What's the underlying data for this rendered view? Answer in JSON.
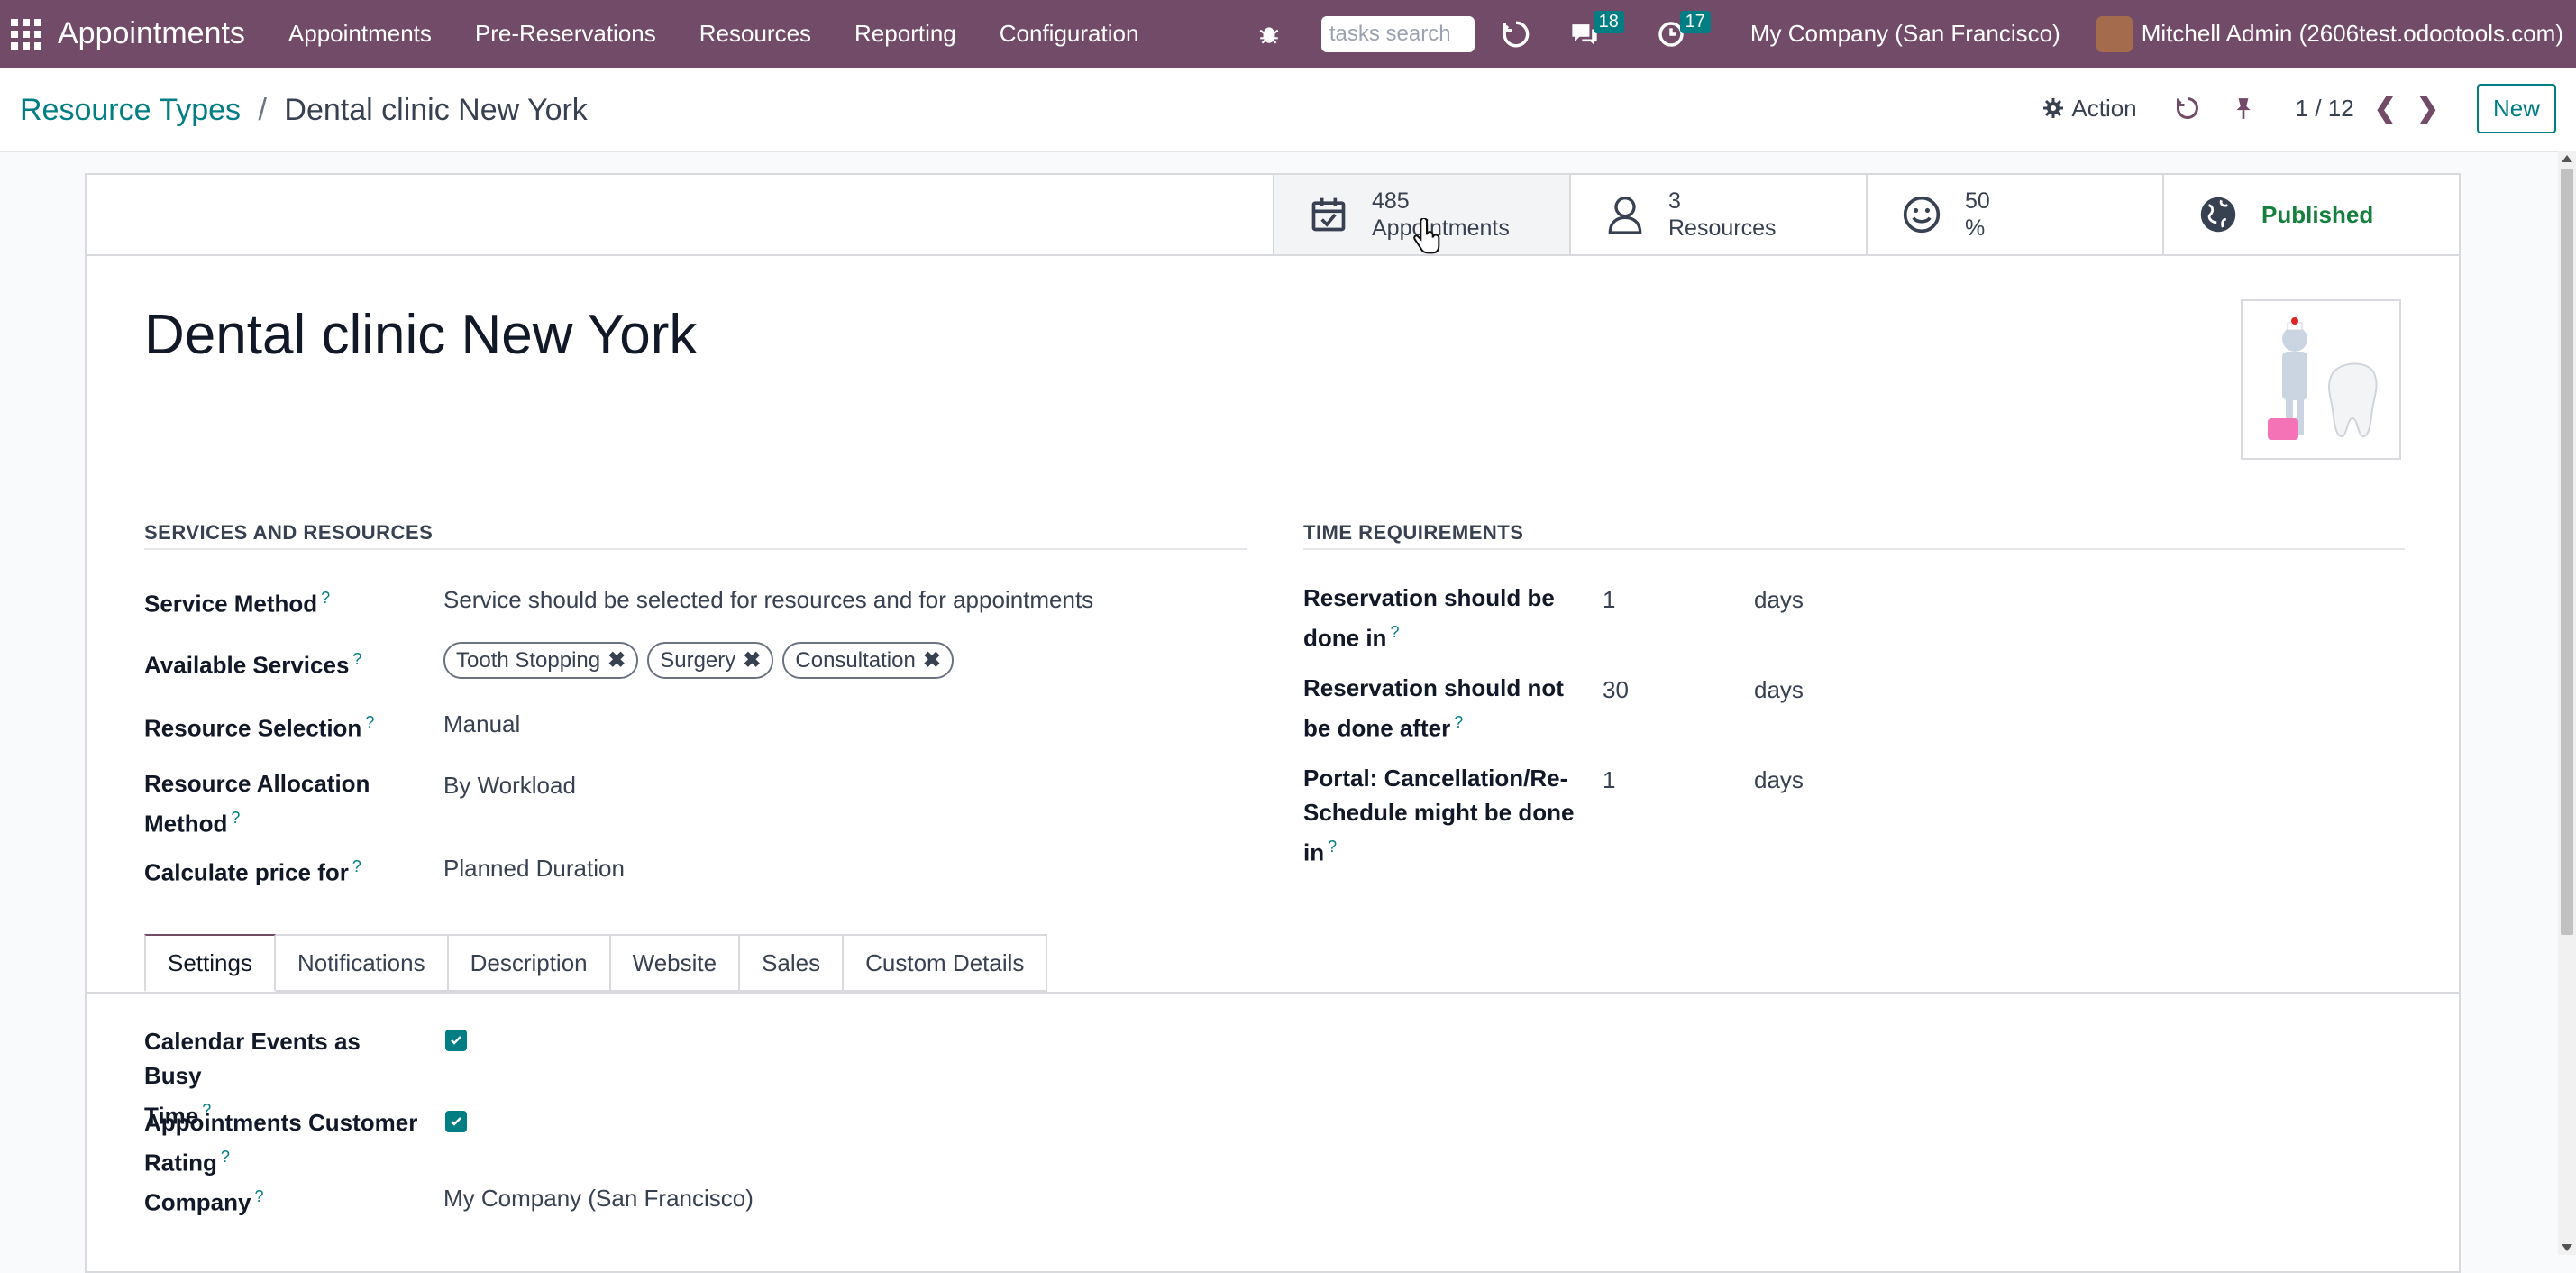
{
  "navbar": {
    "brand": "Appointments",
    "menu": [
      "Appointments",
      "Pre-Reservations",
      "Resources",
      "Reporting",
      "Configuration"
    ],
    "search_placeholder": "tasks search",
    "messages_badge": "18",
    "activities_badge": "17",
    "company": "My Company (San Francisco)",
    "user": "Mitchell Admin (2606test.odootools.com)"
  },
  "control_panel": {
    "breadcrumb_parent": "Resource Types",
    "breadcrumb_sep": "/",
    "breadcrumb_current": "Dental clinic New York",
    "action_label": "Action",
    "pager": "1 / 12",
    "new_label": "New"
  },
  "stat_buttons": {
    "appointments": {
      "value": "485",
      "label": "Appointments"
    },
    "resources": {
      "value": "3",
      "label": "Resources"
    },
    "rating": {
      "value": "50",
      "label": "%"
    },
    "published": "Published"
  },
  "record": {
    "title": "Dental clinic New York"
  },
  "services_group": {
    "title": "SERVICES AND RESOURCES",
    "service_method_label": "Service Method",
    "service_method_value": "Service should be selected for resources and for appointments",
    "available_services_label": "Available Services",
    "available_services": [
      "Tooth Stopping",
      "Surgery",
      "Consultation"
    ],
    "resource_selection_label": "Resource Selection",
    "resource_selection_value": "Manual",
    "allocation_label_1": "Resource Allocation",
    "allocation_label_2": "Method",
    "allocation_value": "By Workload",
    "price_label": "Calculate price for",
    "price_value": "Planned Duration"
  },
  "time_group": {
    "title": "TIME REQUIREMENTS",
    "done_in_label_1": "Reservation should be",
    "done_in_label_2": "done in",
    "done_in_value": "1",
    "not_after_label_1": "Reservation should not",
    "not_after_label_2": "be done after",
    "not_after_value": "30",
    "portal_label_1": "Portal: Cancellation/Re-",
    "portal_label_2": "Schedule might be done",
    "portal_label_3": "in",
    "portal_value": "1",
    "unit": "days"
  },
  "tabs": [
    "Settings",
    "Notifications",
    "Description",
    "Website",
    "Sales",
    "Custom Details"
  ],
  "settings": {
    "busy_label_1": "Calendar Events as Busy",
    "busy_label_2": "Time",
    "busy_checked": true,
    "rating_label_1": "Appointments Customer",
    "rating_label_2": "Rating",
    "rating_checked": true,
    "company_label": "Company",
    "company_value": "My Company (San Francisco)"
  },
  "help_mark": "?",
  "colors": {
    "brand": "#714b67",
    "accent": "#017e84",
    "published": "#15803d"
  }
}
